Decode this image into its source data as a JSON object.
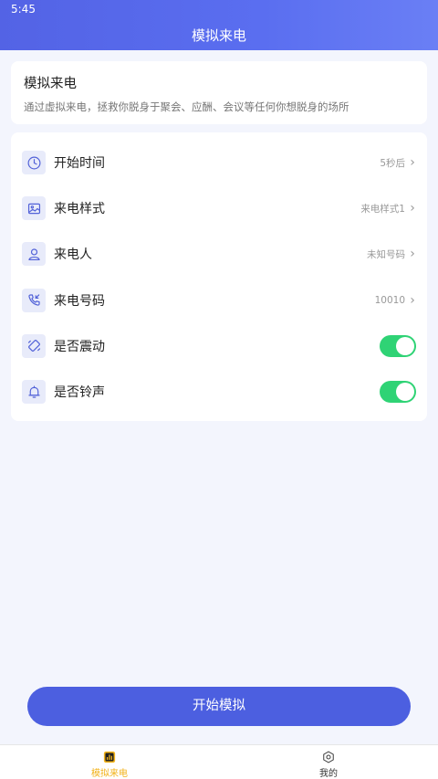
{
  "status_bar": {
    "time": "5:45"
  },
  "header": {
    "title": "模拟来电"
  },
  "intro": {
    "title": "模拟来电",
    "description": "通过虚拟来电，拯救你脱身于聚会、应酬、会议等任何你想脱身的场所"
  },
  "settings": {
    "start_time": {
      "label": "开始时间",
      "value": "5秒后",
      "icon": "clock-icon"
    },
    "call_style": {
      "label": "来电样式",
      "value": "来电样式1",
      "icon": "image-icon"
    },
    "caller": {
      "label": "来电人",
      "value": "未知号码",
      "icon": "person-icon"
    },
    "caller_number": {
      "label": "来电号码",
      "value": "10010",
      "icon": "phone-incoming-icon"
    },
    "vibrate": {
      "label": "是否震动",
      "enabled": true,
      "icon": "vibrate-icon"
    },
    "ringtone": {
      "label": "是否铃声",
      "enabled": true,
      "icon": "bell-icon"
    }
  },
  "start_button": {
    "label": "开始模拟"
  },
  "tabbar": {
    "tabs": [
      {
        "label": "模拟来电",
        "icon": "chart-icon",
        "active": true
      },
      {
        "label": "我的",
        "icon": "hexagon-settings-icon",
        "active": false
      }
    ]
  },
  "colors": {
    "primary": "#4c5fe0",
    "header_gradient_start": "#5363e5",
    "toggle_on": "#2fd375",
    "tab_active": "#f2b31b",
    "background": "#f3f5fd"
  }
}
